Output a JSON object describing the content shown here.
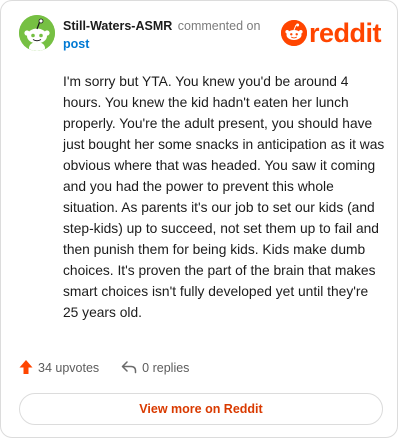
{
  "header": {
    "author": "Still-Waters-ASMR",
    "action_text": "commented on",
    "post_link": "post",
    "brand_name": "reddit"
  },
  "comment": {
    "body": "I'm sorry but YTA. You knew you'd be around 4 hours. You knew the kid hadn't eaten her lunch properly. You're the adult present, you should have just bought her some snacks in anticipation as it was obvious where that was headed. You saw it coming and you had the power to prevent this whole situation. As parents it's our job to set our kids (and step-kids) up to succeed, not set them up to fail and then punish them for being kids. Kids make dumb choices. It's proven the part of the brain that makes smart choices isn't fully developed yet until they're 25 years old."
  },
  "actions": {
    "upvotes": "34 upvotes",
    "replies": "0 replies"
  },
  "footer": {
    "view_more": "View more on Reddit"
  },
  "colors": {
    "brand": "#ff4500",
    "link": "#0079d3",
    "avatar_bg": "#76c043",
    "view_more_text": "#d93a00"
  },
  "icons": {
    "avatar": "snoo-avatar-icon",
    "brand": "reddit-logo-icon",
    "upvote": "upvote-arrow-icon",
    "reply": "reply-arrow-icon"
  }
}
